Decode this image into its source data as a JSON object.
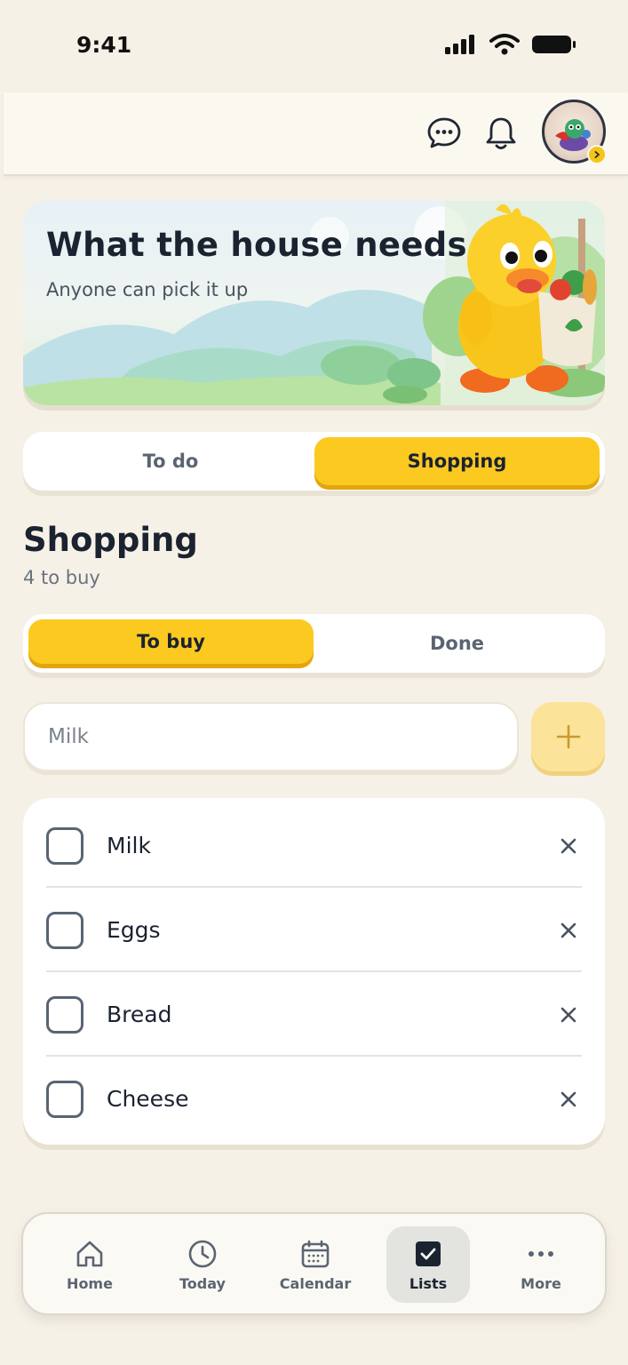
{
  "status": {
    "time": "9:41"
  },
  "hero": {
    "title": "What the house needs",
    "subtitle": "Anyone can pick it up"
  },
  "top_tabs": [
    {
      "label": "To do",
      "active": false
    },
    {
      "label": "Shopping",
      "active": true
    }
  ],
  "section": {
    "title": "Shopping",
    "subtitle": "4 to buy"
  },
  "filter_tabs": [
    {
      "label": "To buy",
      "active": true
    },
    {
      "label": "Done",
      "active": false
    }
  ],
  "add_item": {
    "placeholder": "Milk"
  },
  "items": [
    {
      "label": "Milk",
      "checked": false
    },
    {
      "label": "Eggs",
      "checked": false
    },
    {
      "label": "Bread",
      "checked": false
    },
    {
      "label": "Cheese",
      "checked": false
    }
  ],
  "nav": [
    {
      "label": "Home",
      "icon": "home-icon"
    },
    {
      "label": "Today",
      "icon": "clock-icon"
    },
    {
      "label": "Calendar",
      "icon": "calendar-icon"
    },
    {
      "label": "Lists",
      "icon": "checkbox-icon",
      "active": true
    },
    {
      "label": "More",
      "icon": "more-icon"
    }
  ],
  "colors": {
    "accent": "#fbc920",
    "background": "#f6f1e6"
  }
}
